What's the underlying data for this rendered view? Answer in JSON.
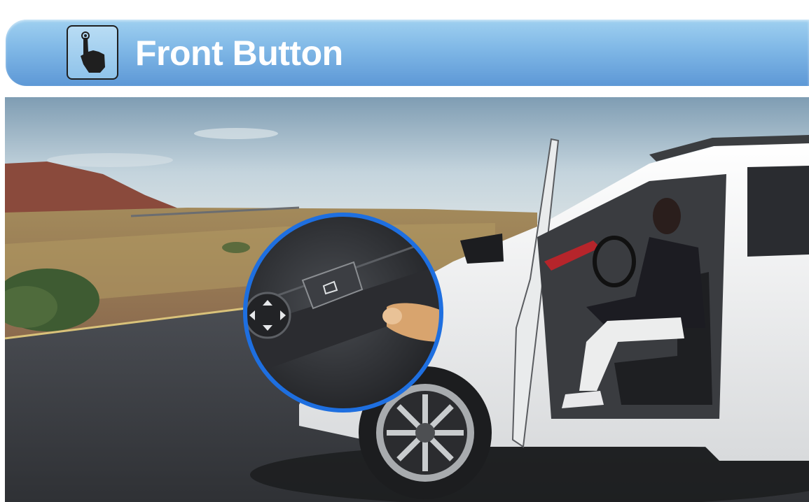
{
  "banner": {
    "title": "Front Button",
    "icon": "press-button-icon",
    "colors": {
      "top": "#9fd0f0",
      "bottom": "#5d98d6",
      "text": "#ffffff"
    }
  },
  "photo": {
    "icon": "car-open-door-image",
    "inset_icon": "trunk-release-button-icon",
    "accent": "#1e6fe0"
  }
}
